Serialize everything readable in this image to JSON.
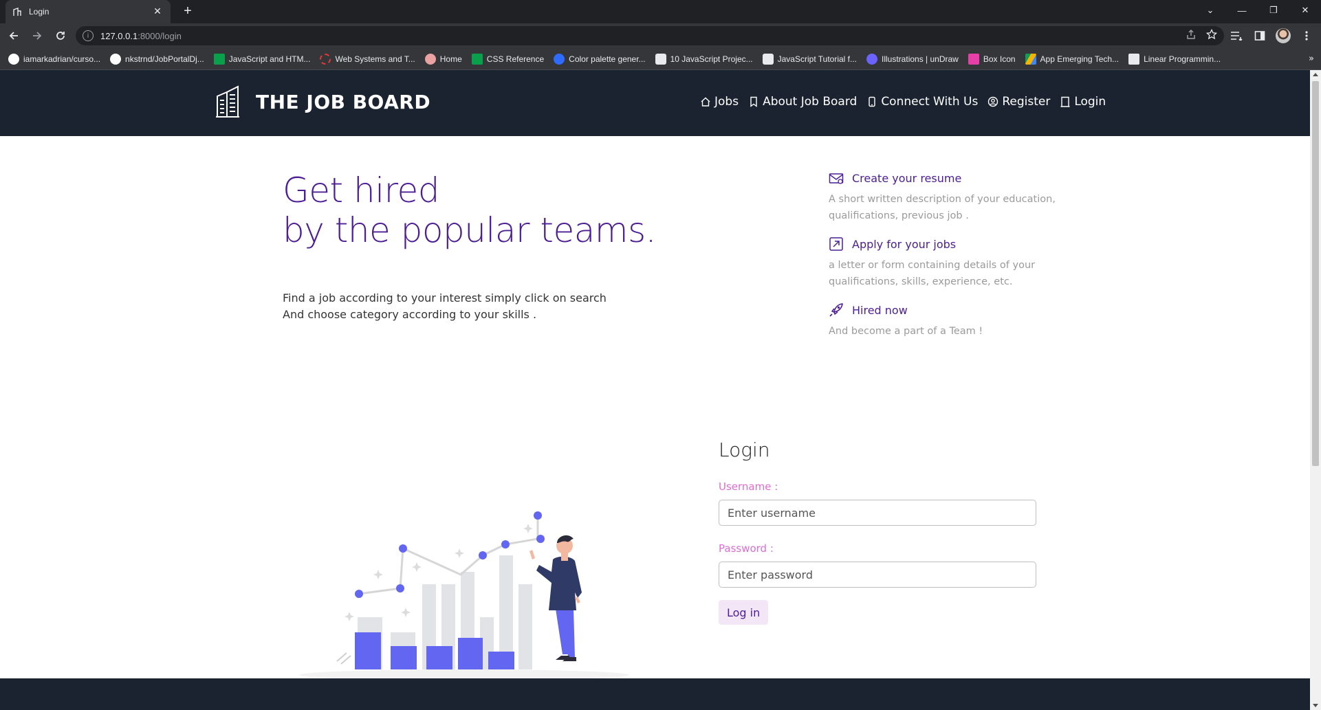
{
  "browser": {
    "tab": {
      "title": "Login",
      "close": "✕"
    },
    "new_tab": "+",
    "window_controls": {
      "tabsearch": "⌄",
      "minimize": "—",
      "restore": "❐",
      "close": "✕"
    },
    "url": {
      "host": "127.0.0.1",
      "path": ":8000/login"
    },
    "bookmarks": [
      {
        "label": "iamarkadrian/curso...",
        "icon": "github-icon",
        "color": "#ffffff"
      },
      {
        "label": "nkstrnd/JobPortalDj...",
        "icon": "github-icon",
        "color": "#ffffff"
      },
      {
        "label": "JavaScript and HTM...",
        "icon": "w3-icon",
        "color": "#0a9f4b"
      },
      {
        "label": "Web Systems and T...",
        "icon": "ring-icon",
        "color": "#e53935"
      },
      {
        "label": "Home",
        "icon": "home-site-icon",
        "color": "#e9a1a1"
      },
      {
        "label": "CSS Reference",
        "icon": "w3-icon",
        "color": "#0a9f4b"
      },
      {
        "label": "Color palette gener...",
        "icon": "coolors-icon",
        "color": "#2f6bff"
      },
      {
        "label": "10 JavaScript Projec...",
        "icon": "hex-icon",
        "color": "#ffffff"
      },
      {
        "label": "JavaScript Tutorial f...",
        "icon": "hex-icon",
        "color": "#ffffff"
      },
      {
        "label": "Illustrations | unDraw",
        "icon": "undraw-icon",
        "color": "#6c63ff"
      },
      {
        "label": "Box Icon",
        "icon": "boxicon-icon",
        "color": "#e63fa7"
      },
      {
        "label": "App Emerging Tech...",
        "icon": "drive-icon",
        "color": "#f4b400"
      },
      {
        "label": "Linear Programmin...",
        "icon": "doc-check-icon",
        "color": "#ffffff"
      }
    ],
    "bookmarks_more": "»"
  },
  "site": {
    "brand": "THE JOB BOARD",
    "nav": [
      {
        "label": "Jobs",
        "icon": "home-icon"
      },
      {
        "label": "About Job Board",
        "icon": "bookmark-icon"
      },
      {
        "label": "Connect With Us",
        "icon": "phone-icon"
      },
      {
        "label": "Register",
        "icon": "user-circle-icon"
      },
      {
        "label": "Login",
        "icon": "door-icon"
      }
    ]
  },
  "hero": {
    "title_line1": "Get hired",
    "title_line2": "by the popular teams.",
    "text_line1": "Find a job according to your interest simply click on search",
    "text_line2": "And choose category according to your skills ."
  },
  "features": [
    {
      "title": "Create your resume",
      "desc": "A short written description of your education, qualifications, previous job .",
      "icon": "envelope-icon"
    },
    {
      "title": "Apply for your jobs",
      "desc": "a letter or form containing details of your qualifications, skills, experience, etc.",
      "icon": "arrow-out-icon"
    },
    {
      "title": "Hired now",
      "desc": "And become a part of a Team !",
      "icon": "rocket-icon"
    }
  ],
  "login": {
    "title": "Login",
    "username_label": "Username :",
    "username_placeholder": "Enter username",
    "password_label": "Password :",
    "password_placeholder": "Enter password",
    "submit": "Log in"
  },
  "colors": {
    "header_bg": "#1b2330",
    "accent_purple": "#4c1d95",
    "label_pink": "#e16bd6",
    "illustration_blue": "#6366f1"
  }
}
